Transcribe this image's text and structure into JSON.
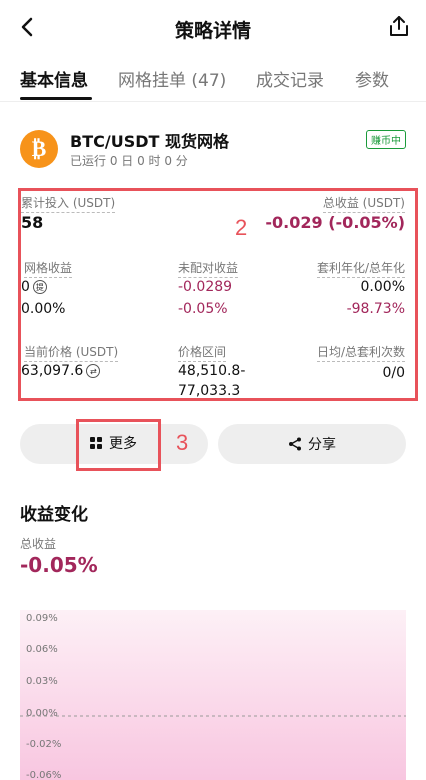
{
  "header": {
    "title": "策略详情"
  },
  "tabs": [
    {
      "label": "基本信息",
      "active": true
    },
    {
      "label": "网格挂单 (47)",
      "active": false
    },
    {
      "label": "成交记录",
      "active": false
    },
    {
      "label": "参数",
      "active": false
    }
  ],
  "strategy": {
    "name": "BTC/USDT 现货网格",
    "runtime": "已运行 0 日 0 时 0 分",
    "status": "赚币中"
  },
  "stats": {
    "invest_label": "累计投入 (USDT)",
    "invest_value": "58",
    "total_profit_label": "总收益 (USDT)",
    "total_profit_value": "-0.029 (-0.05%)",
    "grid_profit_label": "网格收益",
    "grid_profit_value": "0",
    "grid_profit_pct": "0.00%",
    "unmatched_label": "未配对收益",
    "unmatched_value": "-0.0289",
    "unmatched_pct": "-0.05%",
    "arb_label": "套利年化/总年化",
    "arb_value": "0.00%",
    "arb_total": "-98.73%",
    "price_label": "当前价格 (USDT)",
    "price_value": "63,097.6",
    "range_label": "价格区间",
    "range_low": "48,510.8-",
    "range_high": "77,033.3",
    "daily_label": "日均/总套利次数",
    "daily_value": "0/0"
  },
  "annotations": {
    "box2": "2",
    "box3": "3"
  },
  "actions": {
    "more_label": "更多",
    "share_label": "分享"
  },
  "profit_chart": {
    "section_title": "收益变化",
    "label": "总收益",
    "value": "-0.05%"
  },
  "chart_data": {
    "type": "area",
    "title": "",
    "yticks": [
      "0.09%",
      "0.06%",
      "0.03%",
      "0.00%",
      "-0.02%",
      "-0.06%"
    ],
    "ytick_values": [
      0.09,
      0.06,
      0.03,
      0.0,
      -0.02,
      -0.06
    ],
    "ylim": [
      -0.06,
      0.09
    ],
    "series": [
      {
        "values": [
          0.0,
          -0.05
        ]
      }
    ],
    "fill_color": "#f7b8d8"
  }
}
